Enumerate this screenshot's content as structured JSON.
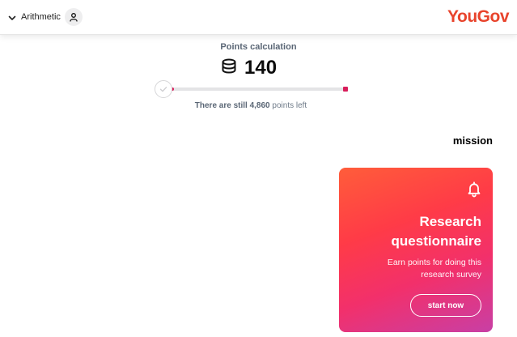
{
  "header": {
    "menu_label": "Arithmetic",
    "logo_text": "YouGov",
    "logo_color": "#e8442c"
  },
  "points": {
    "title": "Points calculation",
    "value": "140",
    "progress_fraction": 0.028,
    "left_prefix": "There are still",
    "left_amount": "4,860",
    "left_suffix": "points left",
    "accent_color": "#d81e5b"
  },
  "mission": {
    "heading": "mission",
    "card": {
      "title_line1": "Research",
      "title_line2": "questionnaire",
      "description_line1": "Earn points for doing this",
      "description_line2": "research survey",
      "button_label": "start now",
      "icon": "bell-icon"
    }
  }
}
